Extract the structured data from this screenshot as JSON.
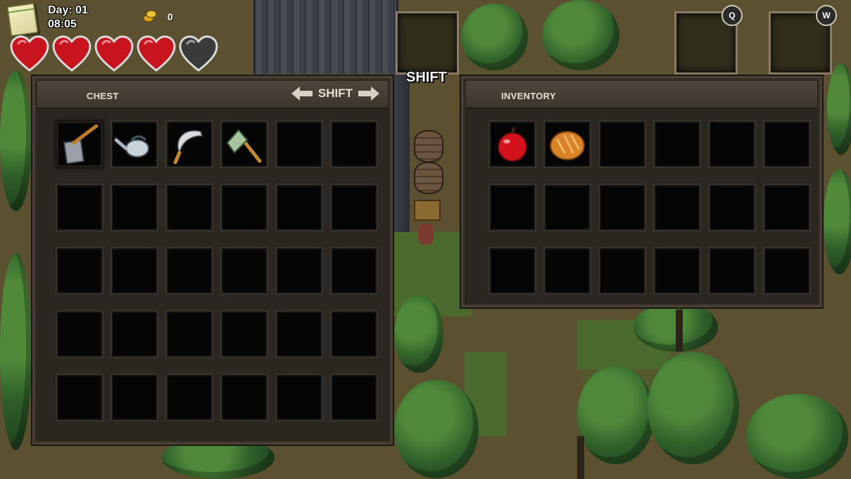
{
  "hud": {
    "day": "Day: 01",
    "time": "08:05",
    "gold": "0",
    "hearts": [
      {
        "state": "full"
      },
      {
        "state": "full"
      },
      {
        "state": "full"
      },
      {
        "state": "full"
      },
      {
        "state": "empty"
      }
    ],
    "slots": {
      "shift_label": "SHIFT",
      "q_key": "Q",
      "w_key": "W"
    }
  },
  "chest": {
    "title": "CHEST",
    "nav_label": "SHIFT",
    "rows": 5,
    "cols": 6,
    "items": [
      "hoe-icon",
      "watering-can-icon",
      "sickle-icon",
      "axe-icon"
    ]
  },
  "inventory": {
    "title": "INVENTORY",
    "rows": 3,
    "cols": 6,
    "items": [
      "apple-icon",
      "bread-icon"
    ]
  },
  "colors": {
    "heart_full": "#c8141e",
    "heart_empty": "#3a3a3a",
    "panel_bg": "#2b2620",
    "slot_bg": "#050505"
  }
}
